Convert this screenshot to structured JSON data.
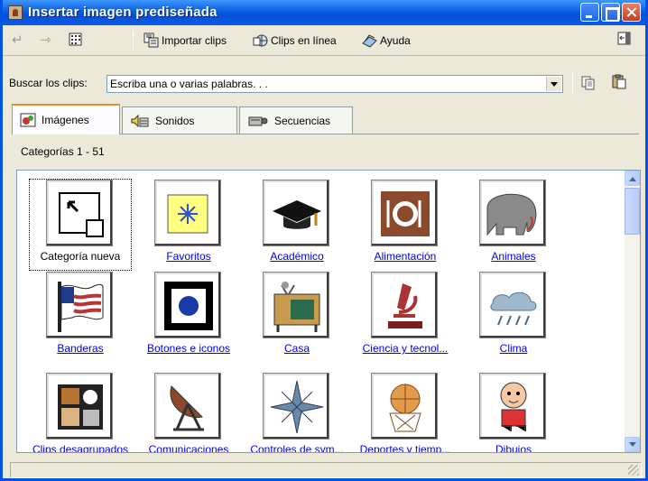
{
  "window": {
    "title": "Insertar imagen prediseñada"
  },
  "toolbar": {
    "back_icon": "arrow-back-icon",
    "forward_icon": "arrow-forward-icon",
    "import_label": "Importar clips",
    "online_label": "Clips en línea",
    "help_label": "Ayuda"
  },
  "search": {
    "label": "Buscar los clips:",
    "value": "Escriba una o varias palabras. . ."
  },
  "tabs": [
    {
      "label": "Imágenes",
      "icon": "images-icon"
    },
    {
      "label": "Sonidos",
      "icon": "speaker-icon"
    },
    {
      "label": "Secuencias",
      "icon": "projector-icon"
    }
  ],
  "categories_count": "Categorías 1 - 51",
  "categories": [
    {
      "label": "Categoría nueva",
      "icon": "new-category-icon"
    },
    {
      "label": "Favoritos",
      "icon": "star-icon"
    },
    {
      "label": "Académico",
      "icon": "graduation-cap-icon"
    },
    {
      "label": "Alimentación",
      "icon": "plate-cutlery-icon"
    },
    {
      "label": "Animales",
      "icon": "elephant-icon"
    },
    {
      "label": "Banderas",
      "icon": "flag-icon"
    },
    {
      "label": "Botones e iconos",
      "icon": "button-icon"
    },
    {
      "label": "Casa",
      "icon": "tv-icon"
    },
    {
      "label": "Ciencia y tecnol...",
      "icon": "microscope-icon"
    },
    {
      "label": "Clima",
      "icon": "cloud-rain-icon"
    },
    {
      "label": "Clips desagrupados",
      "icon": "collage-icon"
    },
    {
      "label": "Comunicaciones",
      "icon": "satellite-dish-icon"
    },
    {
      "label": "Controles de sym...",
      "icon": "compass-star-icon"
    },
    {
      "label": "Deportes y tiemp...",
      "icon": "basketball-icon"
    },
    {
      "label": "Dibujos",
      "icon": "cartoon-child-icon"
    }
  ],
  "colors": {
    "titlebar": "#0a5fe0",
    "link": "#0000ee",
    "face": "#ece9d8"
  }
}
